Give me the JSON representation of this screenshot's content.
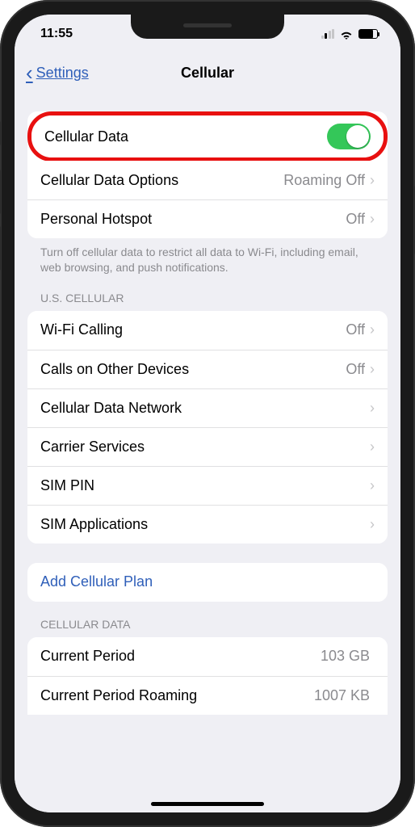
{
  "status_bar": {
    "time": "11:55"
  },
  "nav": {
    "back_label": "Settings",
    "title": "Cellular"
  },
  "section1": {
    "cellular_data_label": "Cellular Data",
    "options_label": "Cellular Data Options",
    "options_value": "Roaming Off",
    "hotspot_label": "Personal Hotspot",
    "hotspot_value": "Off",
    "footer": "Turn off cellular data to restrict all data to Wi-Fi, including email, web browsing, and push notifications."
  },
  "section2": {
    "header": "U.S. CELLULAR",
    "wifi_calling_label": "Wi-Fi Calling",
    "wifi_calling_value": "Off",
    "other_devices_label": "Calls on Other Devices",
    "other_devices_value": "Off",
    "data_network_label": "Cellular Data Network",
    "carrier_services_label": "Carrier Services",
    "sim_pin_label": "SIM PIN",
    "sim_apps_label": "SIM Applications"
  },
  "add_plan": {
    "label": "Add Cellular Plan"
  },
  "section3": {
    "header": "CELLULAR DATA",
    "current_period_label": "Current Period",
    "current_period_value": "103 GB",
    "roaming_label": "Current Period Roaming",
    "roaming_value": "1007 KB"
  }
}
